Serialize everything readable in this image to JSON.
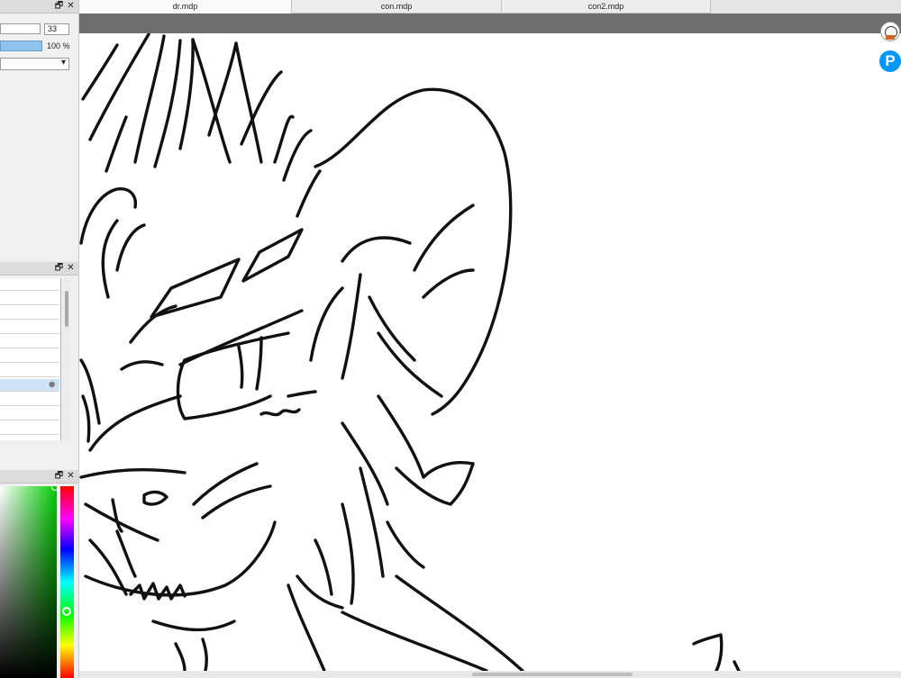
{
  "tabs": [
    {
      "label": "dr.mdp"
    },
    {
      "label": "con.mdp"
    },
    {
      "label": "con2.mdp"
    }
  ],
  "brush_panel": {
    "size_value": "33",
    "opacity_value": "100 %"
  },
  "colors": {
    "canvas_bg": "#ffffff",
    "panel_bg": "#f0f0f0",
    "toolbar_dark": "#6e6e6e",
    "selected_layer": "#cfe3f6",
    "pixiv_blue": "#0096fa",
    "current_color": "#00cc00"
  },
  "icons": {
    "panel_restore": "restore-icon",
    "panel_close": "close-icon",
    "dropdown": "chevron-down-icon",
    "layer_settings": "gear-icon",
    "app_logo": "mascot-icon",
    "pixiv_logo": "pixiv-icon"
  },
  "glyphs": {
    "restore": "🗗",
    "close": "✕",
    "chevron": "▾",
    "gear": "✹",
    "pixiv": "P"
  }
}
